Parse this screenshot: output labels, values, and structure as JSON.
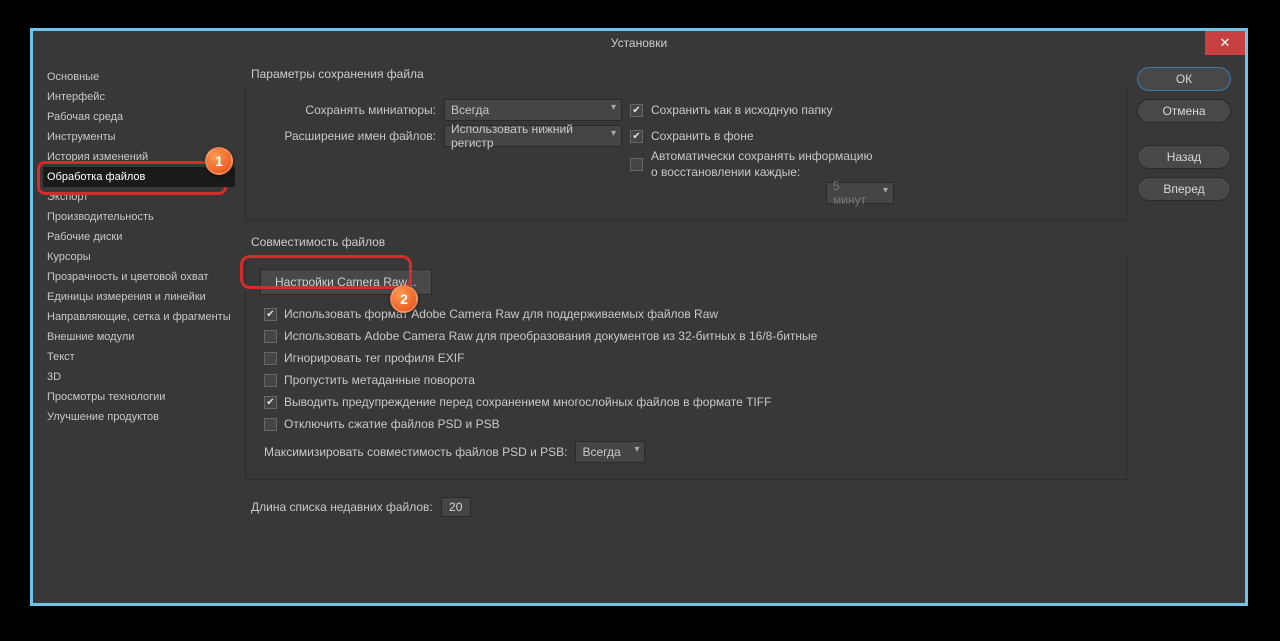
{
  "window": {
    "title": "Установки"
  },
  "sidebar": {
    "items": [
      "Основные",
      "Интерфейс",
      "Рабочая среда",
      "Инструменты",
      "История изменений",
      "Обработка файлов",
      "Экспорт",
      "Производительность",
      "Рабочие диски",
      "Курсоры",
      "Прозрачность и цветовой охват",
      "Единицы измерения и линейки",
      "Направляющие, сетка и фрагменты",
      "Внешние модули",
      "Текст",
      "3D",
      "Просмотры технологии",
      "Улучшение продуктов"
    ],
    "activeIndex": 5
  },
  "saving": {
    "title": "Параметры сохранения файла",
    "thumbnails_label": "Сохранять миниатюры:",
    "thumbnails_value": "Всегда",
    "ext_label": "Расширение имен файлов:",
    "ext_value": "Использовать нижний регистр",
    "save_original": "Сохранить как в исходную папку",
    "save_bg": "Сохранить в фоне",
    "auto_recover": "Автоматически сохранять информацию о восстановлении каждые:",
    "recover_interval": "5 минут"
  },
  "compat": {
    "title": "Совместимость файлов",
    "camera_raw_btn": "Настройки Camera Raw...",
    "use_acr": "Использовать формат Adobe Camera Raw для поддерживаемых файлов Raw",
    "use_acr_32": "Использовать Adobe Camera Raw для преобразования документов из 32-битных в 16/8-битные",
    "ignore_exif": "Игнорировать тег профиля EXIF",
    "skip_rotate": "Пропустить метаданные поворота",
    "tiff_warn": "Выводить предупреждение перед сохранением многослойных файлов в формате TIFF",
    "disable_psd": "Отключить сжатие файлов PSD и PSB",
    "max_compat_label": "Максимизировать совместимость файлов PSD и PSB:",
    "max_compat_value": "Всегда"
  },
  "recent": {
    "label": "Длина списка недавних файлов:",
    "value": "20"
  },
  "buttons": {
    "ok": "ОК",
    "cancel": "Отмена",
    "back": "Назад",
    "forward": "Вперед"
  },
  "badges": {
    "one": "1",
    "two": "2"
  }
}
